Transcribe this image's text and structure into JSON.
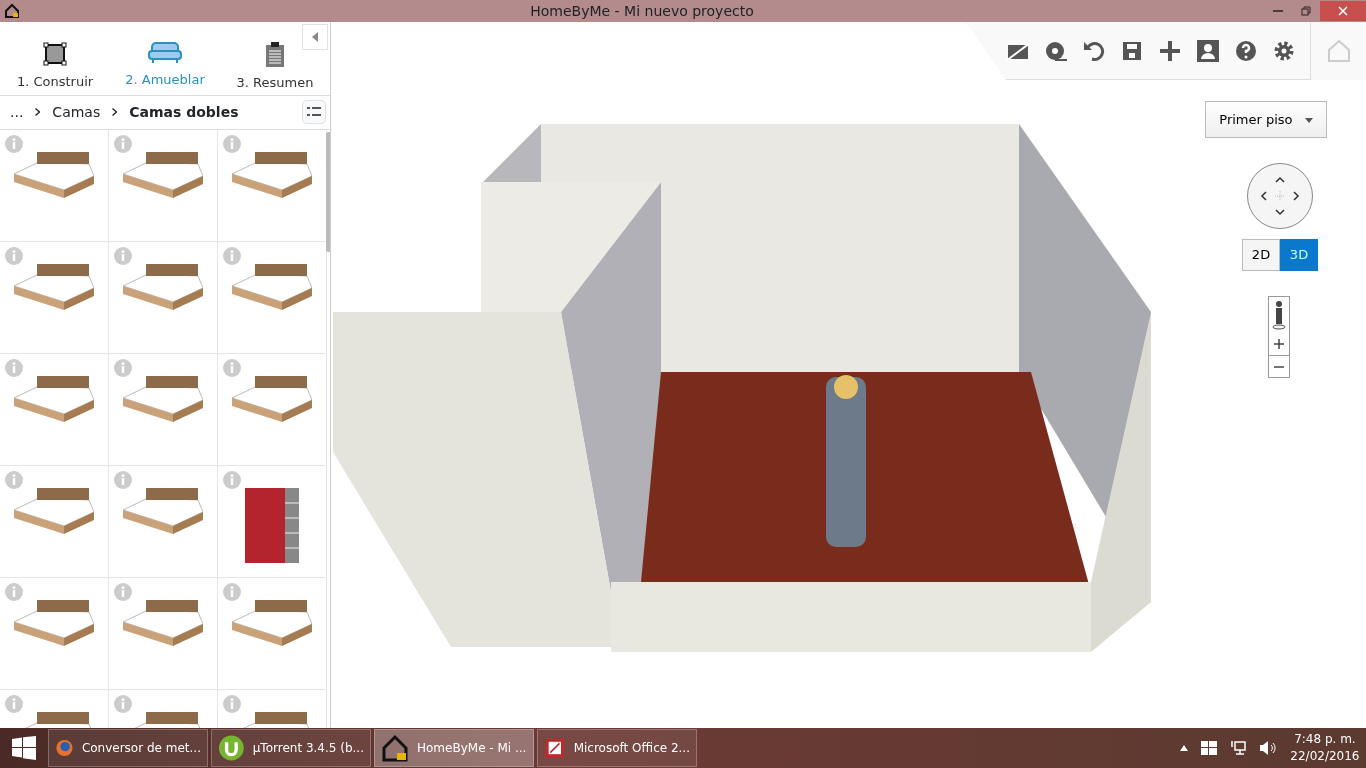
{
  "window": {
    "title": "HomeByMe - Mi nuevo proyecto"
  },
  "steps": [
    {
      "label": "1. Construir",
      "selected": false,
      "kind": "build"
    },
    {
      "label": "2. Amueblar",
      "selected": true,
      "kind": "furnish"
    },
    {
      "label": "3. Resumen",
      "selected": false,
      "kind": "summary"
    }
  ],
  "breadcrumb": [
    {
      "label": "...",
      "current": false
    },
    {
      "label": "Camas",
      "current": false
    },
    {
      "label": "Camas dobles",
      "current": true
    }
  ],
  "products": [
    {
      "kind": "bed"
    },
    {
      "kind": "bed"
    },
    {
      "kind": "bed"
    },
    {
      "kind": "bed"
    },
    {
      "kind": "bed"
    },
    {
      "kind": "bed"
    },
    {
      "kind": "bed"
    },
    {
      "kind": "bed"
    },
    {
      "kind": "bed"
    },
    {
      "kind": "bed"
    },
    {
      "kind": "bed"
    },
    {
      "kind": "wardrobe"
    },
    {
      "kind": "bed"
    },
    {
      "kind": "bed"
    },
    {
      "kind": "bed"
    },
    {
      "kind": "bed"
    },
    {
      "kind": "bed"
    },
    {
      "kind": "bed"
    }
  ],
  "floor_selector": {
    "value": "Primer piso"
  },
  "view_modes": [
    {
      "label": "2D",
      "selected": false
    },
    {
      "label": "3D",
      "selected": true
    }
  ],
  "taskbar": {
    "items": [
      {
        "label": "Conversor de met...",
        "active": false,
        "kind": "browser"
      },
      {
        "label": "µTorrent 3.4.5  (b...",
        "active": false,
        "kind": "torrent"
      },
      {
        "label": "HomeByMe - Mi ...",
        "active": true,
        "kind": "home"
      },
      {
        "label": "Microsoft Office 2...",
        "active": false,
        "kind": "office"
      }
    ],
    "time": "7:48 p. m.",
    "date": "22/02/2016"
  }
}
